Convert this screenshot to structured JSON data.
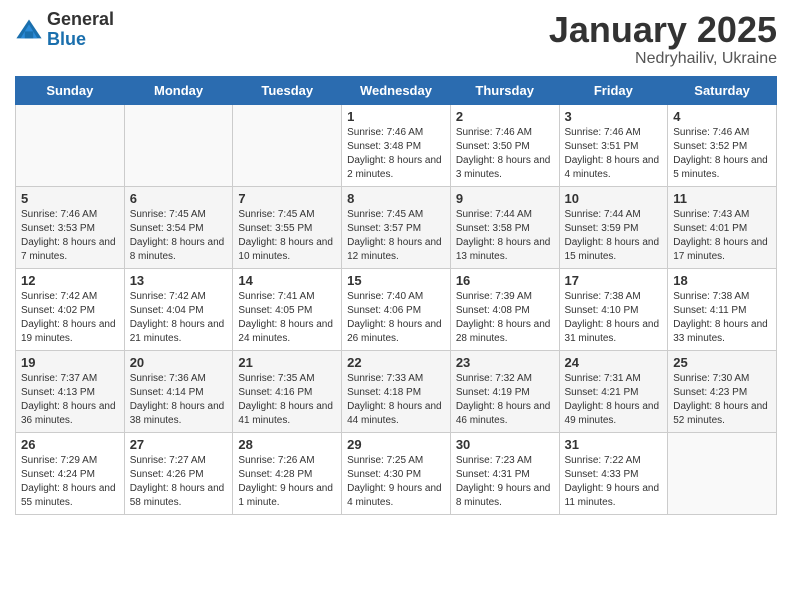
{
  "logo": {
    "general": "General",
    "blue": "Blue"
  },
  "header": {
    "month": "January 2025",
    "location": "Nedryhailiv, Ukraine"
  },
  "weekdays": [
    "Sunday",
    "Monday",
    "Tuesday",
    "Wednesday",
    "Thursday",
    "Friday",
    "Saturday"
  ],
  "weeks": [
    [
      {
        "day": "",
        "sunrise": "",
        "sunset": "",
        "daylight": ""
      },
      {
        "day": "",
        "sunrise": "",
        "sunset": "",
        "daylight": ""
      },
      {
        "day": "",
        "sunrise": "",
        "sunset": "",
        "daylight": ""
      },
      {
        "day": "1",
        "sunrise": "Sunrise: 7:46 AM",
        "sunset": "Sunset: 3:48 PM",
        "daylight": "Daylight: 8 hours and 2 minutes."
      },
      {
        "day": "2",
        "sunrise": "Sunrise: 7:46 AM",
        "sunset": "Sunset: 3:50 PM",
        "daylight": "Daylight: 8 hours and 3 minutes."
      },
      {
        "day": "3",
        "sunrise": "Sunrise: 7:46 AM",
        "sunset": "Sunset: 3:51 PM",
        "daylight": "Daylight: 8 hours and 4 minutes."
      },
      {
        "day": "4",
        "sunrise": "Sunrise: 7:46 AM",
        "sunset": "Sunset: 3:52 PM",
        "daylight": "Daylight: 8 hours and 5 minutes."
      }
    ],
    [
      {
        "day": "5",
        "sunrise": "Sunrise: 7:46 AM",
        "sunset": "Sunset: 3:53 PM",
        "daylight": "Daylight: 8 hours and 7 minutes."
      },
      {
        "day": "6",
        "sunrise": "Sunrise: 7:45 AM",
        "sunset": "Sunset: 3:54 PM",
        "daylight": "Daylight: 8 hours and 8 minutes."
      },
      {
        "day": "7",
        "sunrise": "Sunrise: 7:45 AM",
        "sunset": "Sunset: 3:55 PM",
        "daylight": "Daylight: 8 hours and 10 minutes."
      },
      {
        "day": "8",
        "sunrise": "Sunrise: 7:45 AM",
        "sunset": "Sunset: 3:57 PM",
        "daylight": "Daylight: 8 hours and 12 minutes."
      },
      {
        "day": "9",
        "sunrise": "Sunrise: 7:44 AM",
        "sunset": "Sunset: 3:58 PM",
        "daylight": "Daylight: 8 hours and 13 minutes."
      },
      {
        "day": "10",
        "sunrise": "Sunrise: 7:44 AM",
        "sunset": "Sunset: 3:59 PM",
        "daylight": "Daylight: 8 hours and 15 minutes."
      },
      {
        "day": "11",
        "sunrise": "Sunrise: 7:43 AM",
        "sunset": "Sunset: 4:01 PM",
        "daylight": "Daylight: 8 hours and 17 minutes."
      }
    ],
    [
      {
        "day": "12",
        "sunrise": "Sunrise: 7:42 AM",
        "sunset": "Sunset: 4:02 PM",
        "daylight": "Daylight: 8 hours and 19 minutes."
      },
      {
        "day": "13",
        "sunrise": "Sunrise: 7:42 AM",
        "sunset": "Sunset: 4:04 PM",
        "daylight": "Daylight: 8 hours and 21 minutes."
      },
      {
        "day": "14",
        "sunrise": "Sunrise: 7:41 AM",
        "sunset": "Sunset: 4:05 PM",
        "daylight": "Daylight: 8 hours and 24 minutes."
      },
      {
        "day": "15",
        "sunrise": "Sunrise: 7:40 AM",
        "sunset": "Sunset: 4:06 PM",
        "daylight": "Daylight: 8 hours and 26 minutes."
      },
      {
        "day": "16",
        "sunrise": "Sunrise: 7:39 AM",
        "sunset": "Sunset: 4:08 PM",
        "daylight": "Daylight: 8 hours and 28 minutes."
      },
      {
        "day": "17",
        "sunrise": "Sunrise: 7:38 AM",
        "sunset": "Sunset: 4:10 PM",
        "daylight": "Daylight: 8 hours and 31 minutes."
      },
      {
        "day": "18",
        "sunrise": "Sunrise: 7:38 AM",
        "sunset": "Sunset: 4:11 PM",
        "daylight": "Daylight: 8 hours and 33 minutes."
      }
    ],
    [
      {
        "day": "19",
        "sunrise": "Sunrise: 7:37 AM",
        "sunset": "Sunset: 4:13 PM",
        "daylight": "Daylight: 8 hours and 36 minutes."
      },
      {
        "day": "20",
        "sunrise": "Sunrise: 7:36 AM",
        "sunset": "Sunset: 4:14 PM",
        "daylight": "Daylight: 8 hours and 38 minutes."
      },
      {
        "day": "21",
        "sunrise": "Sunrise: 7:35 AM",
        "sunset": "Sunset: 4:16 PM",
        "daylight": "Daylight: 8 hours and 41 minutes."
      },
      {
        "day": "22",
        "sunrise": "Sunrise: 7:33 AM",
        "sunset": "Sunset: 4:18 PM",
        "daylight": "Daylight: 8 hours and 44 minutes."
      },
      {
        "day": "23",
        "sunrise": "Sunrise: 7:32 AM",
        "sunset": "Sunset: 4:19 PM",
        "daylight": "Daylight: 8 hours and 46 minutes."
      },
      {
        "day": "24",
        "sunrise": "Sunrise: 7:31 AM",
        "sunset": "Sunset: 4:21 PM",
        "daylight": "Daylight: 8 hours and 49 minutes."
      },
      {
        "day": "25",
        "sunrise": "Sunrise: 7:30 AM",
        "sunset": "Sunset: 4:23 PM",
        "daylight": "Daylight: 8 hours and 52 minutes."
      }
    ],
    [
      {
        "day": "26",
        "sunrise": "Sunrise: 7:29 AM",
        "sunset": "Sunset: 4:24 PM",
        "daylight": "Daylight: 8 hours and 55 minutes."
      },
      {
        "day": "27",
        "sunrise": "Sunrise: 7:27 AM",
        "sunset": "Sunset: 4:26 PM",
        "daylight": "Daylight: 8 hours and 58 minutes."
      },
      {
        "day": "28",
        "sunrise": "Sunrise: 7:26 AM",
        "sunset": "Sunset: 4:28 PM",
        "daylight": "Daylight: 9 hours and 1 minute."
      },
      {
        "day": "29",
        "sunrise": "Sunrise: 7:25 AM",
        "sunset": "Sunset: 4:30 PM",
        "daylight": "Daylight: 9 hours and 4 minutes."
      },
      {
        "day": "30",
        "sunrise": "Sunrise: 7:23 AM",
        "sunset": "Sunset: 4:31 PM",
        "daylight": "Daylight: 9 hours and 8 minutes."
      },
      {
        "day": "31",
        "sunrise": "Sunrise: 7:22 AM",
        "sunset": "Sunset: 4:33 PM",
        "daylight": "Daylight: 9 hours and 11 minutes."
      },
      {
        "day": "",
        "sunrise": "",
        "sunset": "",
        "daylight": ""
      }
    ]
  ]
}
